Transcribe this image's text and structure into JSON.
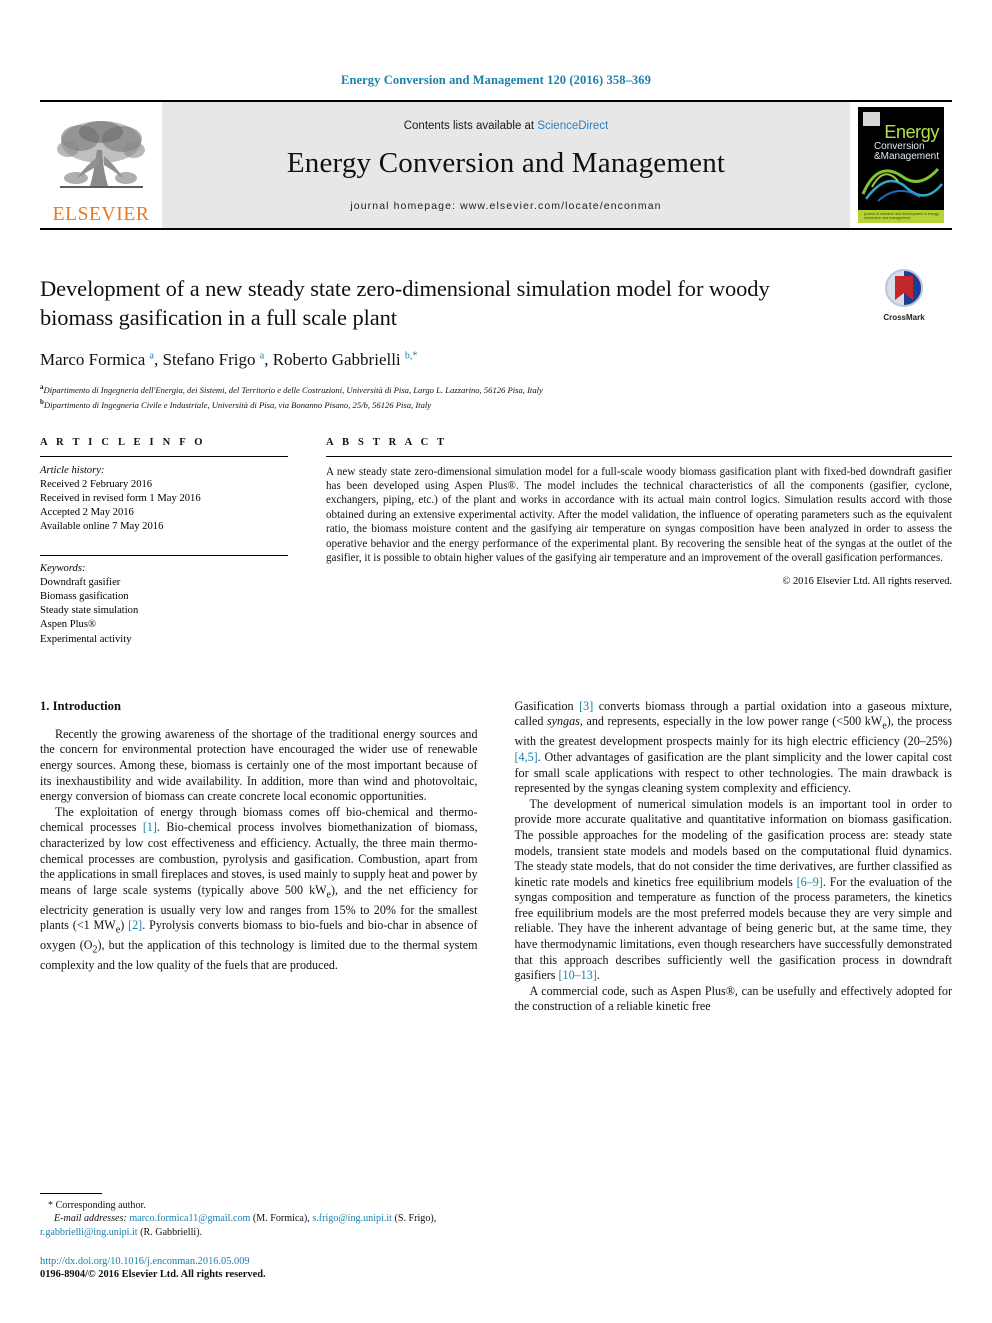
{
  "running_head": "Energy Conversion and Management 120 (2016) 358–369",
  "masthead": {
    "publisher_name": "ELSEVIER",
    "contents_prefix": "Contents lists available at ",
    "contents_link": "ScienceDirect",
    "journal_name": "Energy Conversion and Management",
    "homepage": "journal homepage: www.elsevier.com/locate/enconman",
    "cover": {
      "title_main": "Energy",
      "title_sub_1": "Conversion",
      "title_sub_2": "&Management",
      "strip_text": "journal of research and development in energy conversion and management"
    }
  },
  "article": {
    "title": "Development of a new steady state zero-dimensional simulation model for woody biomass gasification in a full scale plant",
    "crossmark_label": "CrossMark",
    "authors_html": "Marco Formica <sup>a</sup>, Stefano Frigo <sup>a</sup>, Roberto Gabbrielli <sup>b,*</sup>",
    "affiliations": [
      {
        "marker": "a",
        "text": "Dipartimento di Ingegneria dell'Energia, dei Sistemi, del Territorio e delle Costruzioni, Università di Pisa, Largo L. Lazzarino, 56126 Pisa, Italy"
      },
      {
        "marker": "b",
        "text": "Dipartimento di Ingegneria Civile e Industriale, Università di Pisa, via Bonanno Pisano, 25/b, 56126 Pisa, Italy"
      }
    ]
  },
  "article_info": {
    "heading": "A R T I C L E   I N F O",
    "history_label": "Article history:",
    "history": [
      "Received 2 February 2016",
      "Received in revised form 1 May 2016",
      "Accepted 2 May 2016",
      "Available online 7 May 2016"
    ],
    "keywords_label": "Keywords:",
    "keywords": [
      "Downdraft gasifier",
      "Biomass gasification",
      "Steady state simulation",
      "Aspen Plus®",
      "Experimental activity"
    ]
  },
  "abstract": {
    "heading": "A B S T R A C T",
    "text": "A new steady state zero-dimensional simulation model for a full-scale woody biomass gasification plant with fixed-bed downdraft gasifier has been developed using Aspen Plus®. The model includes the technical characteristics of all the components (gasifier, cyclone, exchangers, piping, etc.) of the plant and works in accordance with its actual main control logics. Simulation results accord with those obtained during an extensive experimental activity. After the model validation, the influence of operating parameters such as the equivalent ratio, the biomass moisture content and the gasifying air temperature on syngas composition have been analyzed in order to assess the operative behavior and the energy performance of the experimental plant. By recovering the sensible heat of the syngas at the outlet of the gasifier, it is possible to obtain higher values of the gasifying air temperature and an improvement of the overall gasification performances.",
    "copyright": "© 2016 Elsevier Ltd. All rights reserved."
  },
  "body": {
    "section_heading": "1. Introduction",
    "left_paragraphs": [
      "Recently the growing awareness of the shortage of the traditional energy sources and the concern for environmental protection have encouraged the wider use of renewable energy sources. Among these, biomass is certainly one of the most important because of its inexhaustibility and wide availability. In addition, more than wind and photovoltaic, energy conversion of biomass can create concrete local economic opportunities."
    ],
    "left_paragraph_2_a": "The exploitation of energy through biomass comes off bio-chemical and thermo-chemical processes ",
    "left_paragraph_2_ref": "[1]",
    "left_paragraph_2_b": ". Bio-chemical process involves biomethanization of biomass, characterized by low cost effectiveness and efficiency. Actually, the three main thermo-chemical processes are combustion, pyrolysis and gasification. Combustion, apart from the applications in small fireplaces and stoves, is used mainly to supply heat and power by means of large scale systems (typically above 500 kW",
    "left_paragraph_2_sub1": "e",
    "left_paragraph_2_c": "), and the net efficiency for electricity generation is usually very low and ranges from 15% to 20% for the smallest plants (<1 MW",
    "left_paragraph_2_sub2": "e",
    "left_paragraph_2_d": ") ",
    "left_paragraph_2_ref2": "[2]",
    "left_paragraph_2_e": ". Pyrolysis converts biomass to bio-fuels and bio-char in absence of oxygen (O",
    "left_paragraph_2_sub3": "2",
    "left_paragraph_2_f": "), but the application of this technology is limited due to the thermal system complexity and the low quality of the fuels that are produced.",
    "right_p1_a": "Gasification ",
    "right_p1_ref": "[3]",
    "right_p1_b": " converts biomass through a partial oxidation into a gaseous mixture, called ",
    "right_p1_italic": "syngas",
    "right_p1_c": ", and represents, especially in the low power range (<500 kW",
    "right_p1_sub": "e",
    "right_p1_d": "), the process with the greatest development prospects mainly for its high electric efficiency (20–25%) ",
    "right_p1_ref2": "[4,5]",
    "right_p1_e": ". Other advantages of gasification are the plant simplicity and the lower capital cost for small scale applications with respect to other technologies. The main drawback is represented by the syngas cleaning system complexity and efficiency.",
    "right_p2_a": "The development of numerical simulation models is an important tool in order to provide more accurate qualitative and quantitative information on biomass gasification. The possible approaches for the modeling of the gasification process are: steady state models, transient state models and models based on the computational fluid dynamics. The steady state models, that do not consider the time derivatives, are further classified as kinetic rate models and kinetics free equilibrium models ",
    "right_p2_ref": "[6–9]",
    "right_p2_b": ". For the evaluation of the syngas composition and temperature as function of the process parameters, the kinetics free equilibrium models are the most preferred models because they are very simple and reliable. They have the inherent advantage of being generic but, at the same time, they have thermodynamic limitations, even though researchers have successfully demonstrated that this approach describes sufficiently well the gasification process in downdraft gasifiers ",
    "right_p2_ref2": "[10–13]",
    "right_p2_c": ".",
    "right_p3": "A commercial code, such as Aspen Plus®, can be usefully and effectively adopted for the construction of a reliable kinetic free"
  },
  "footer": {
    "corresponding_marker": "*",
    "corresponding_text": "Corresponding author.",
    "email_label": "E-mail addresses:",
    "email_1": "marco.formica11@gmail.com",
    "email_1_owner": " (M. Formica), ",
    "email_2": "s.frigo@ing.unipi.it",
    "email_2_owner": " (S. Frigo), ",
    "email_3": "r.gabbrielli@ing.unipi.it",
    "email_3_owner": " (R. Gabbrielli).",
    "doi": "http://dx.doi.org/10.1016/j.enconman.2016.05.009",
    "issn": "0196-8904/© 2016 Elsevier Ltd. All rights reserved."
  },
  "colors": {
    "link": "#1a7fad",
    "elsevier_orange": "#E87722",
    "sciencedirect_blue": "#2f7fc1"
  }
}
